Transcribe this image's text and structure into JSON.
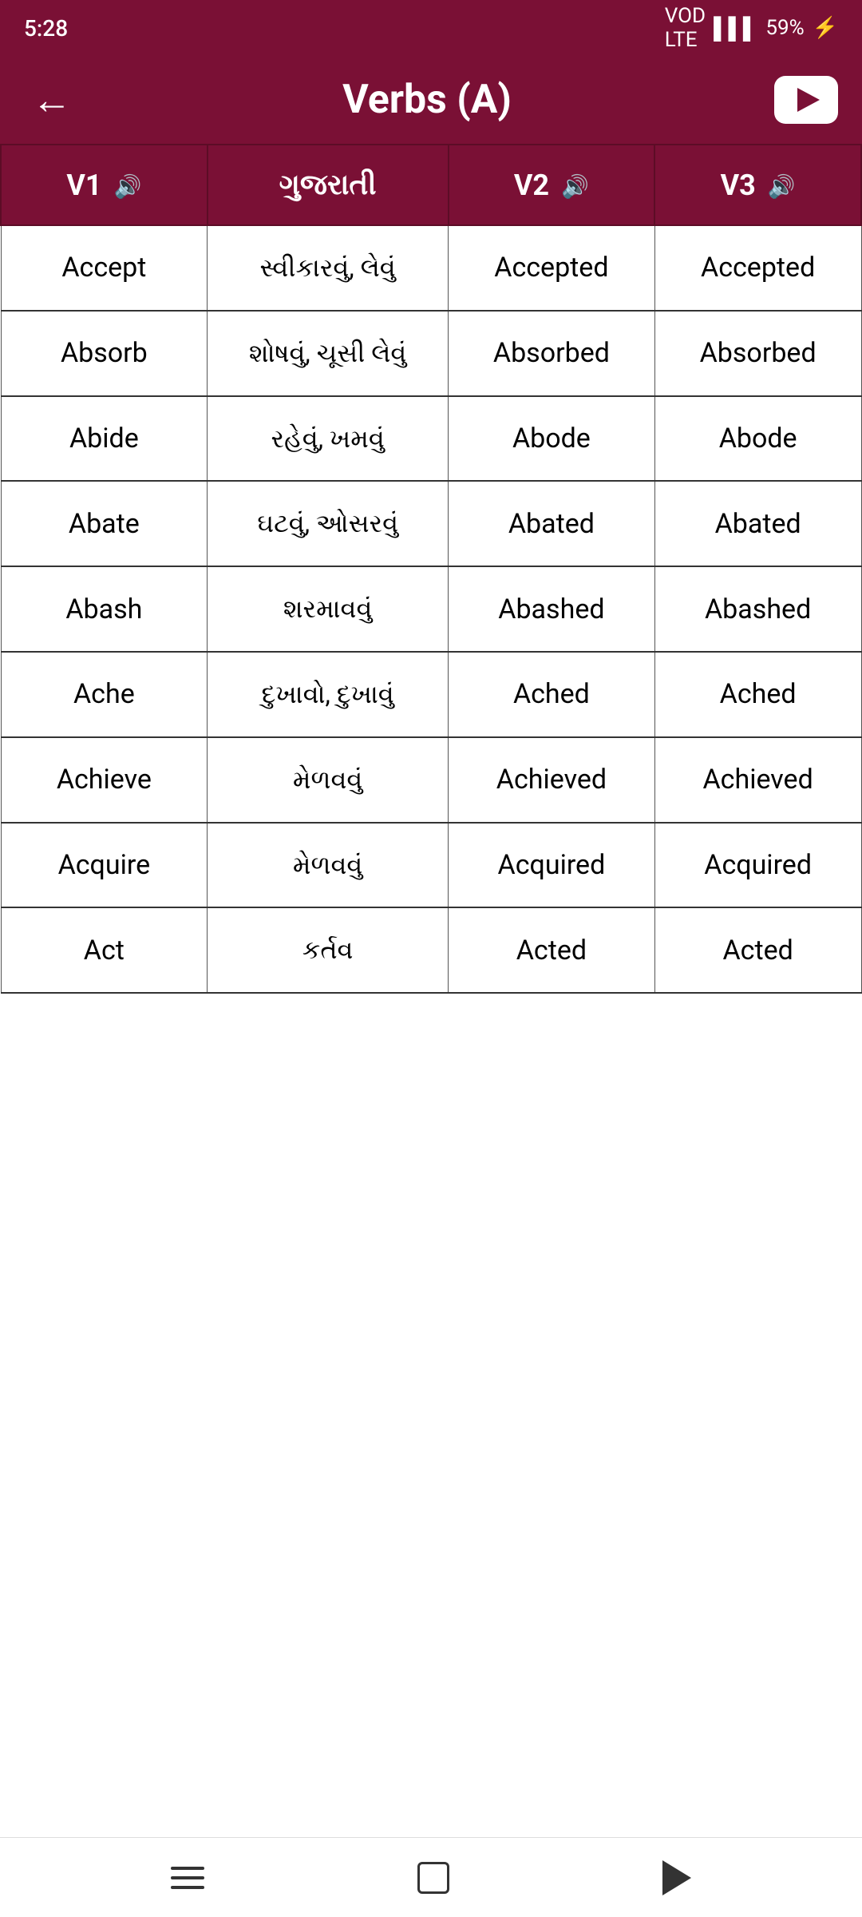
{
  "statusBar": {
    "time": "5:28",
    "battery": "59%",
    "signal": "▌▌▌"
  },
  "toolbar": {
    "title": "Verbs (A)",
    "backLabel": "←",
    "youtubeLabel": "▶"
  },
  "table": {
    "headers": [
      {
        "label": "V1",
        "hasAudio": true
      },
      {
        "label": "ગુજરાતી",
        "hasAudio": false
      },
      {
        "label": "V2",
        "hasAudio": true
      },
      {
        "label": "V3",
        "hasAudio": true
      }
    ],
    "rows": [
      {
        "v1": "Accept",
        "gujarati": "સ્વીકારવું, લેવું",
        "v2": "Accepted",
        "v3": "Accepted"
      },
      {
        "v1": "Absorb",
        "gujarati": "શોષવું, ચૂસી લેવું",
        "v2": "Absorbed",
        "v3": "Absorbed"
      },
      {
        "v1": "Abide",
        "gujarati": "રહેવું, ખમવું",
        "v2": "Abode",
        "v3": "Abode"
      },
      {
        "v1": "Abate",
        "gujarati": "ઘટવું, ઓસરવું",
        "v2": "Abated",
        "v3": "Abated"
      },
      {
        "v1": "Abash",
        "gujarati": "શરમાવવું",
        "v2": "Abashed",
        "v3": "Abashed"
      },
      {
        "v1": "Ache",
        "gujarati": "દુખાવો, દુખાવું",
        "v2": "Ached",
        "v3": "Ached"
      },
      {
        "v1": "Achieve",
        "gujarati": "મેળવવું",
        "v2": "Achieved",
        "v3": "Achieved"
      },
      {
        "v1": "Acquire",
        "gujarati": "મેળવવું",
        "v2": "Acquired",
        "v3": "Acquired"
      },
      {
        "v1": "Act",
        "gujarati": "કર્તવ",
        "v2": "Acted",
        "v3": "Acted"
      }
    ]
  },
  "navbar": {
    "menuLabel": "≡",
    "homeLabel": "□",
    "backLabel": "◁"
  }
}
